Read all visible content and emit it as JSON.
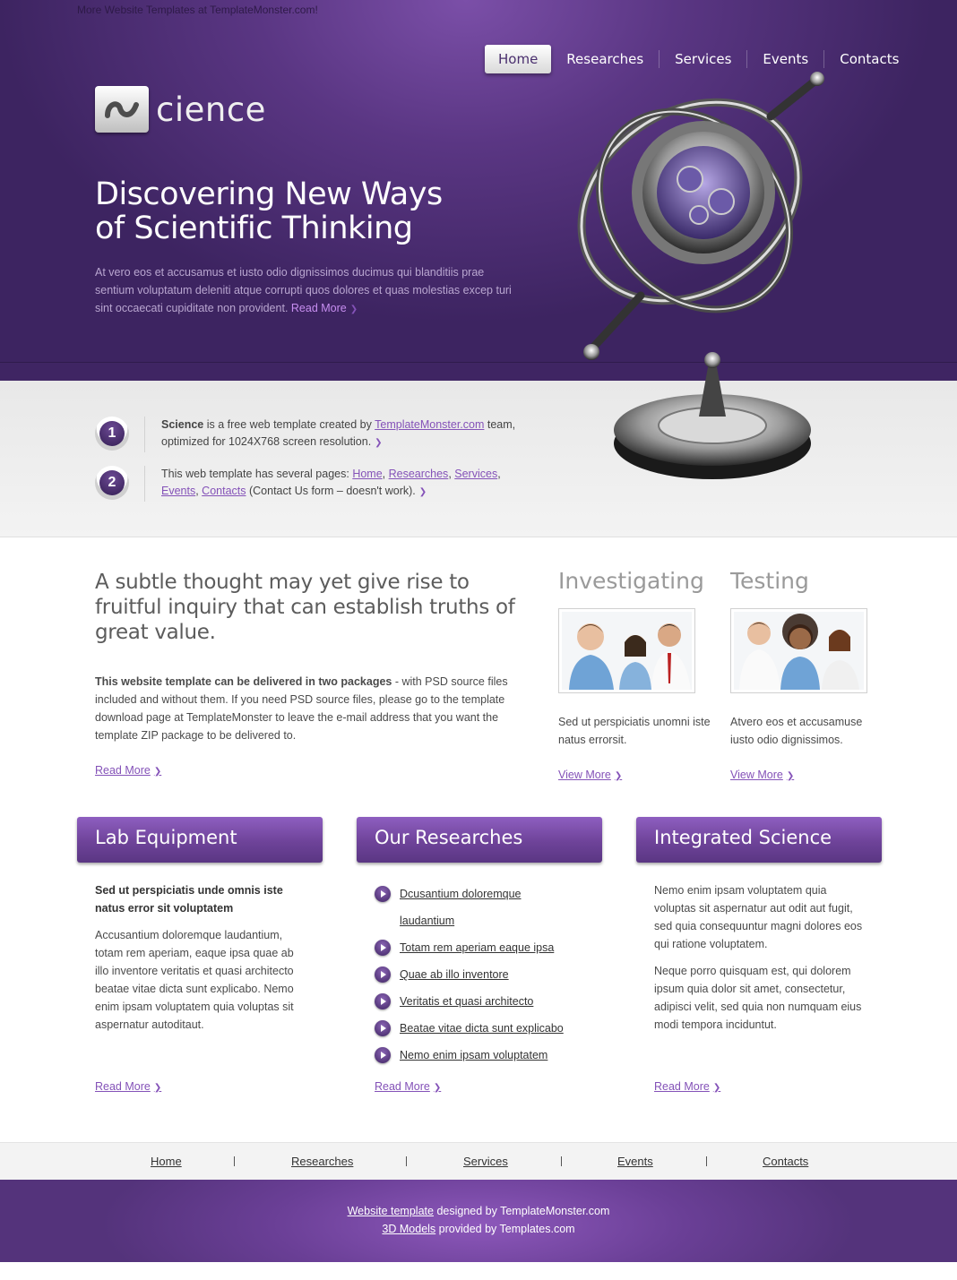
{
  "topbar": {
    "link": "More Website Templates at TemplateMonster.com!"
  },
  "nav": {
    "items": [
      "Home",
      "Researches",
      "Services",
      "Events",
      "Contacts"
    ]
  },
  "logo": {
    "text": "cience"
  },
  "hero": {
    "headline_line1": "Discovering New Ways",
    "headline_line2": "of Scientific Thinking",
    "intro": "At vero eos et accusamus et iusto odio dignissimos ducimus qui blanditiis prae sentium voluptatum deleniti atque corrupti quos dolores et quas molestias excep turi sint occaecati cupiditate non provident.",
    "read_more": "Read More"
  },
  "steps": [
    {
      "num": "1",
      "bold": "Science",
      "text1": " is a free web template created by ",
      "link": "TemplateMonster.com",
      "text2": " team, optimized for 1024X768 screen resolution."
    },
    {
      "num": "2",
      "text1": "This web template has several pages: ",
      "links": [
        "Home",
        "Researches",
        "Services",
        "Events",
        "Contacts"
      ],
      "text2": " (Contact Us form – doesn't work)."
    }
  ],
  "main": {
    "quote": "A subtle thought may yet give rise to fruitful inquiry that can establish truths of great value.",
    "pkg_bold": "This website template can be delivered in two packages",
    "pkg_text": " - with PSD source files included and without them. If you need PSD source files, please go to the template download page at TemplateMonster to leave the e-mail address that you want the template ZIP package to be delivered to.",
    "read_more": "Read More"
  },
  "columns": [
    {
      "title": "Investigating",
      "text": "Sed ut perspiciatis unomni iste natus errorsit.",
      "link": "View More"
    },
    {
      "title": "Testing",
      "text": "Atvero eos et accusamuse iusto odio dignissimos.",
      "link": "View More"
    }
  ],
  "blocks": {
    "lab": {
      "title": "Lab Equipment",
      "bold": "Sed ut perspiciatis unde omnis iste natus error sit voluptatem",
      "text": "Accusantium doloremque laudantium, totam rem aperiam, eaque ipsa quae ab illo inventore veritatis et quasi architecto beatae vitae dicta sunt explicabo. Nemo enim ipsam voluptatem quia voluptas sit aspernatur autoditaut.",
      "read_more": "Read More"
    },
    "research": {
      "title": "Our Researches",
      "items": [
        "Dcusantium doloremque laudantium",
        "Totam rem aperiam eaque ipsa",
        "Quae ab illo inventore",
        "Veritatis et quasi architecto",
        "Beatae vitae dicta sunt explicabo",
        "Nemo enim ipsam voluptatem"
      ],
      "read_more": "Read More"
    },
    "integrated": {
      "title": "Integrated Science",
      "p1": "Nemo enim ipsam voluptatem quia voluptas sit aspernatur aut odit aut fugit, sed quia consequuntur magni dolores eos qui ratione voluptatem.",
      "p2": "Neque porro quisquam est, qui dolorem ipsum quia dolor sit amet, consectetur, adipisci velit, sed quia non numquam eius modi tempora inciduntut.",
      "read_more": "Read More"
    }
  },
  "footer_nav": [
    "Home",
    "Researches",
    "Services",
    "Events",
    "Contacts"
  ],
  "footer": {
    "l1_link": "Website template",
    "l1_text": " designed by TemplateMonster.com",
    "l2_link": "3D Models",
    "l2_text": " provided by Templates.com"
  },
  "colors": {
    "primary": "#5a3683",
    "accent": "#8452b8",
    "link": "#c78ef0"
  }
}
